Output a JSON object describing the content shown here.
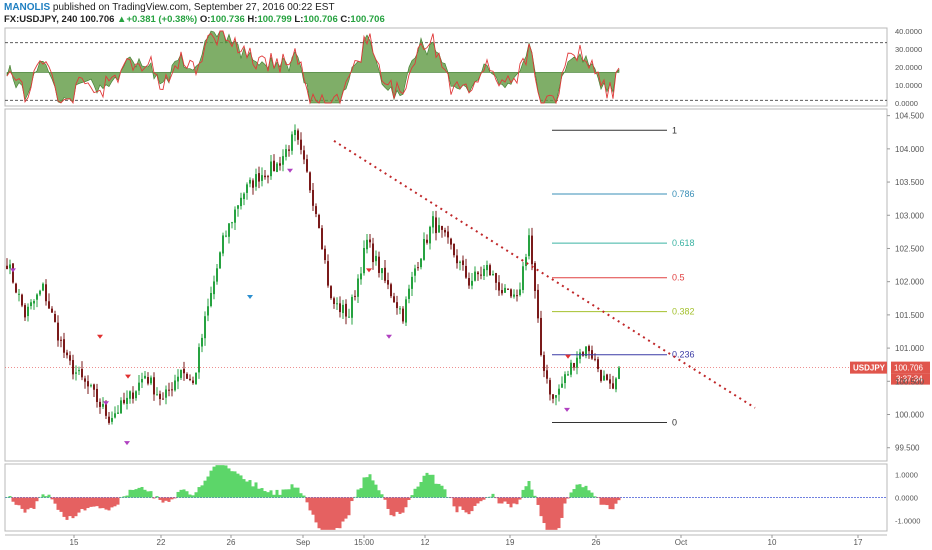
{
  "header": {
    "author": "MANOLIS",
    "published_text": " published on TradingView.com, September 27, 2016 00:22 EST",
    "symbol_interval": "FX:USDJPY, 240",
    "price": "100.706",
    "change_arrow": "▲",
    "change": "+0.381 (+0.38%)",
    "open_label": "O:",
    "open": "100.736",
    "high_label": "H:",
    "high": "100.799",
    "low_label": "L:",
    "low": "100.706",
    "close_label": "C:",
    "close": "100.706"
  },
  "colors": {
    "bull": "#26a240",
    "bear": "#7a1a1a",
    "fib_red": "#e04040",
    "trend": "#c0282a",
    "price_label": "#e0554c"
  },
  "chart_data": [
    {
      "type": "line",
      "name": "oscillator_top",
      "ylim": [
        0,
        40
      ],
      "yticks": [
        "40.0000",
        "30.0000",
        "20.0000",
        "10.0000",
        "0.0000"
      ],
      "reference_lines": [
        33.5,
        1.5
      ],
      "baseline": 17
    },
    {
      "type": "candlestick",
      "name": "USDJPY main",
      "ylim": [
        99.3,
        104.6
      ],
      "yticks": [
        "104.500",
        "104.000",
        "103.500",
        "103.000",
        "102.500",
        "102.000",
        "101.500",
        "101.000",
        "100.500",
        "100.000",
        "99.500"
      ],
      "xticks": [
        "15",
        "22",
        "26",
        "Sep",
        "15:00",
        "12",
        "19",
        "26",
        "Oct",
        "10",
        "17"
      ],
      "last_price_label": "USDJPY",
      "last_price": "100.706",
      "countdown": "3:37:34",
      "fibonacci": [
        {
          "label": "1",
          "price": 104.28
        },
        {
          "label": "0.786",
          "price": 103.32
        },
        {
          "label": "0.618",
          "price": 102.58
        },
        {
          "label": "0.5",
          "price": 102.06
        },
        {
          "label": "0.382",
          "price": 101.55
        },
        {
          "label": "0.236",
          "price": 100.9
        },
        {
          "label": "0",
          "price": 99.88
        }
      ],
      "trendline": {
        "from_price": 104.12,
        "to_price": 100.1
      },
      "anchors": [
        {
          "i": 0,
          "p": 102.3
        },
        {
          "i": 6,
          "p": 101.5
        },
        {
          "i": 12,
          "p": 101.9
        },
        {
          "i": 20,
          "p": 100.8
        },
        {
          "i": 28,
          "p": 100.35
        },
        {
          "i": 34,
          "p": 99.95
        },
        {
          "i": 40,
          "p": 100.2
        },
        {
          "i": 46,
          "p": 100.6
        },
        {
          "i": 52,
          "p": 100.2
        },
        {
          "i": 58,
          "p": 100.7
        },
        {
          "i": 62,
          "p": 100.45
        },
        {
          "i": 66,
          "p": 101.4
        },
        {
          "i": 72,
          "p": 102.6
        },
        {
          "i": 78,
          "p": 103.3
        },
        {
          "i": 84,
          "p": 103.6
        },
        {
          "i": 90,
          "p": 103.75
        },
        {
          "i": 96,
          "p": 104.2
        },
        {
          "i": 100,
          "p": 103.6
        },
        {
          "i": 104,
          "p": 102.9
        },
        {
          "i": 108,
          "p": 101.7
        },
        {
          "i": 114,
          "p": 101.5
        },
        {
          "i": 120,
          "p": 102.6
        },
        {
          "i": 126,
          "p": 102.0
        },
        {
          "i": 132,
          "p": 101.5
        },
        {
          "i": 136,
          "p": 102.2
        },
        {
          "i": 142,
          "p": 102.9
        },
        {
          "i": 148,
          "p": 102.5
        },
        {
          "i": 154,
          "p": 102.0
        },
        {
          "i": 160,
          "p": 102.2
        },
        {
          "i": 166,
          "p": 101.8
        },
        {
          "i": 170,
          "p": 101.7
        },
        {
          "i": 174,
          "p": 102.7
        },
        {
          "i": 178,
          "p": 100.9
        },
        {
          "i": 182,
          "p": 100.2
        },
        {
          "i": 186,
          "p": 100.55
        },
        {
          "i": 190,
          "p": 100.9
        },
        {
          "i": 194,
          "p": 101.0
        },
        {
          "i": 198,
          "p": 100.6
        },
        {
          "i": 202,
          "p": 100.3
        },
        {
          "i": 204,
          "p": 100.706
        }
      ]
    },
    {
      "type": "bar",
      "name": "oscillator_bottom",
      "ylim": [
        -1.45,
        1.45
      ],
      "yticks": [
        "1.0000",
        "0.0000",
        "-1.0000"
      ]
    }
  ]
}
